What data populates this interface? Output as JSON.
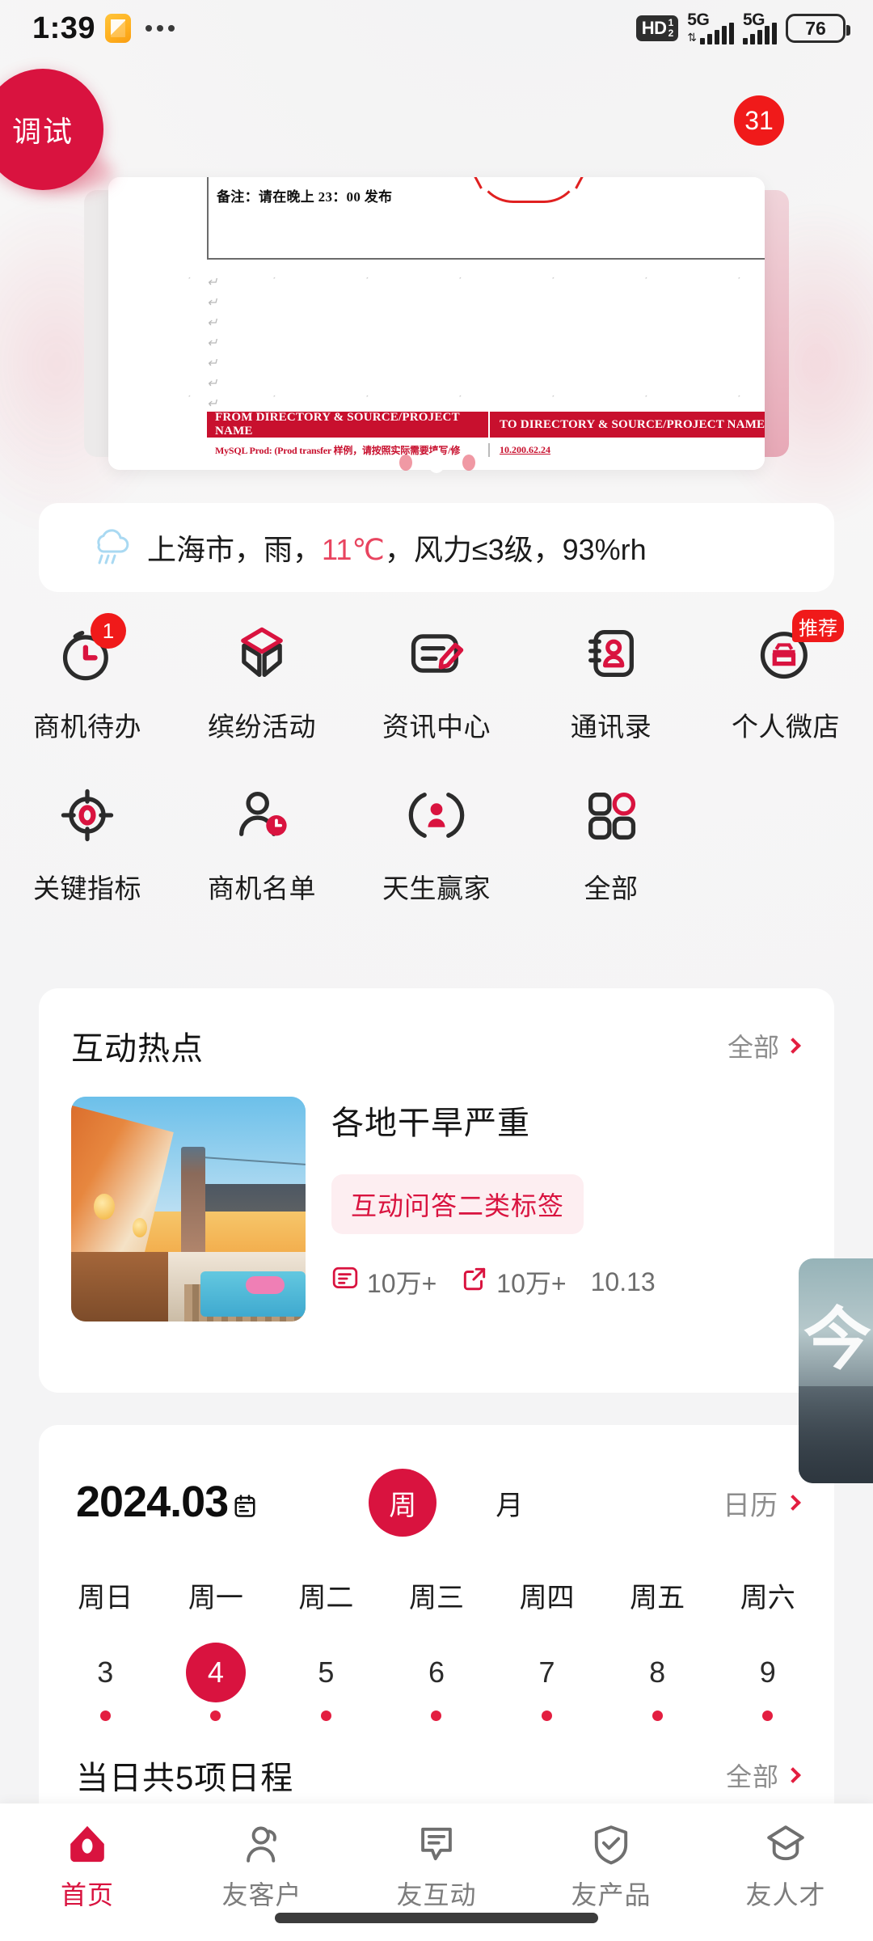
{
  "status_bar": {
    "time": "1:39",
    "app_icon": "note-icon",
    "overflow": "more-dots-icon",
    "hd_label": "HD",
    "hd_sub_top": "1",
    "hd_sub_bottom": "2",
    "network_1": "5G",
    "network_2": "5G",
    "battery_percent": "76"
  },
  "floating": {
    "debug_label": "调试",
    "notification_count": "31"
  },
  "banner": {
    "doc_note": "备注：请在晚上 23：00 发布",
    "table_header_from": "FROM DIRECTORY & SOURCE/PROJECT NAME",
    "table_header_to": "TO DIRECTORY & SOURCE/PROJECT NAME",
    "table_cell_from": "MySQL Prod: (Prod transfer 样例，请按照实际需要填写/修",
    "table_cell_to": "10.200.62.24"
  },
  "weather": {
    "icon": "rain-cloud-icon",
    "city": "上海市，雨，",
    "temperature": "11℃",
    "rest": "，风力≤3级，93%rh"
  },
  "grid": {
    "items": [
      {
        "label": "商机待办",
        "icon": "stopwatch-icon",
        "badge": "1"
      },
      {
        "label": "缤纷活动",
        "icon": "box-3d-icon",
        "badge": ""
      },
      {
        "label": "资讯中心",
        "icon": "document-pen-icon",
        "badge": ""
      },
      {
        "label": "通讯录",
        "icon": "contacts-book-icon",
        "badge": ""
      },
      {
        "label": "个人微店",
        "icon": "shop-circle-icon",
        "badge": "推荐"
      },
      {
        "label": "关键指标",
        "icon": "target-icon",
        "badge": ""
      },
      {
        "label": "商机名单",
        "icon": "person-clock-icon",
        "badge": ""
      },
      {
        "label": "天生赢家",
        "icon": "person-arc-icon",
        "badge": ""
      },
      {
        "label": "全部",
        "icon": "grid-apps-icon",
        "badge": ""
      }
    ]
  },
  "hotspot": {
    "title": "互动热点",
    "more_label": "全部",
    "card": {
      "thumbnail": "courtyard-photo",
      "title": "各地干旱严重",
      "tag": "互动问答二类标签",
      "answer_icon": "answer-icon",
      "answer_count": "10万+",
      "share_icon": "share-icon",
      "share_count": "10万+",
      "date": "10.13"
    },
    "next_card": {
      "thumbnail": "city-photo",
      "partial_text": "今"
    }
  },
  "calendar": {
    "year_month": "2024.03",
    "calendar_icon": "calendar-icon",
    "segment": [
      {
        "label": "周",
        "selected": true
      },
      {
        "label": "月",
        "selected": false
      }
    ],
    "more_label": "日历",
    "weekdays": [
      "周日",
      "周一",
      "周二",
      "周三",
      "周四",
      "周五",
      "周六"
    ],
    "days": [
      {
        "n": "3",
        "selected": false,
        "dot": true
      },
      {
        "n": "4",
        "selected": true,
        "dot": true
      },
      {
        "n": "5",
        "selected": false,
        "dot": true
      },
      {
        "n": "6",
        "selected": false,
        "dot": true
      },
      {
        "n": "7",
        "selected": false,
        "dot": true
      },
      {
        "n": "8",
        "selected": false,
        "dot": true
      },
      {
        "n": "9",
        "selected": false,
        "dot": true
      }
    ],
    "footer_label": "当日共5项日程",
    "footer_more": "全部"
  },
  "tabbar": {
    "items": [
      {
        "label": "首页",
        "icon": "home-icon",
        "active": true
      },
      {
        "label": "友客户",
        "icon": "person-icon",
        "active": false
      },
      {
        "label": "友互动",
        "icon": "chat-icon",
        "active": false
      },
      {
        "label": "友产品",
        "icon": "shield-check-icon",
        "active": false
      },
      {
        "label": "友人才",
        "icon": "graduation-cap-icon",
        "active": false
      }
    ]
  },
  "colors": {
    "brand_red": "#d9133f",
    "badge_red": "#f01a1a",
    "tag_bg": "#fdeef1",
    "muted": "#8d8d8d"
  }
}
